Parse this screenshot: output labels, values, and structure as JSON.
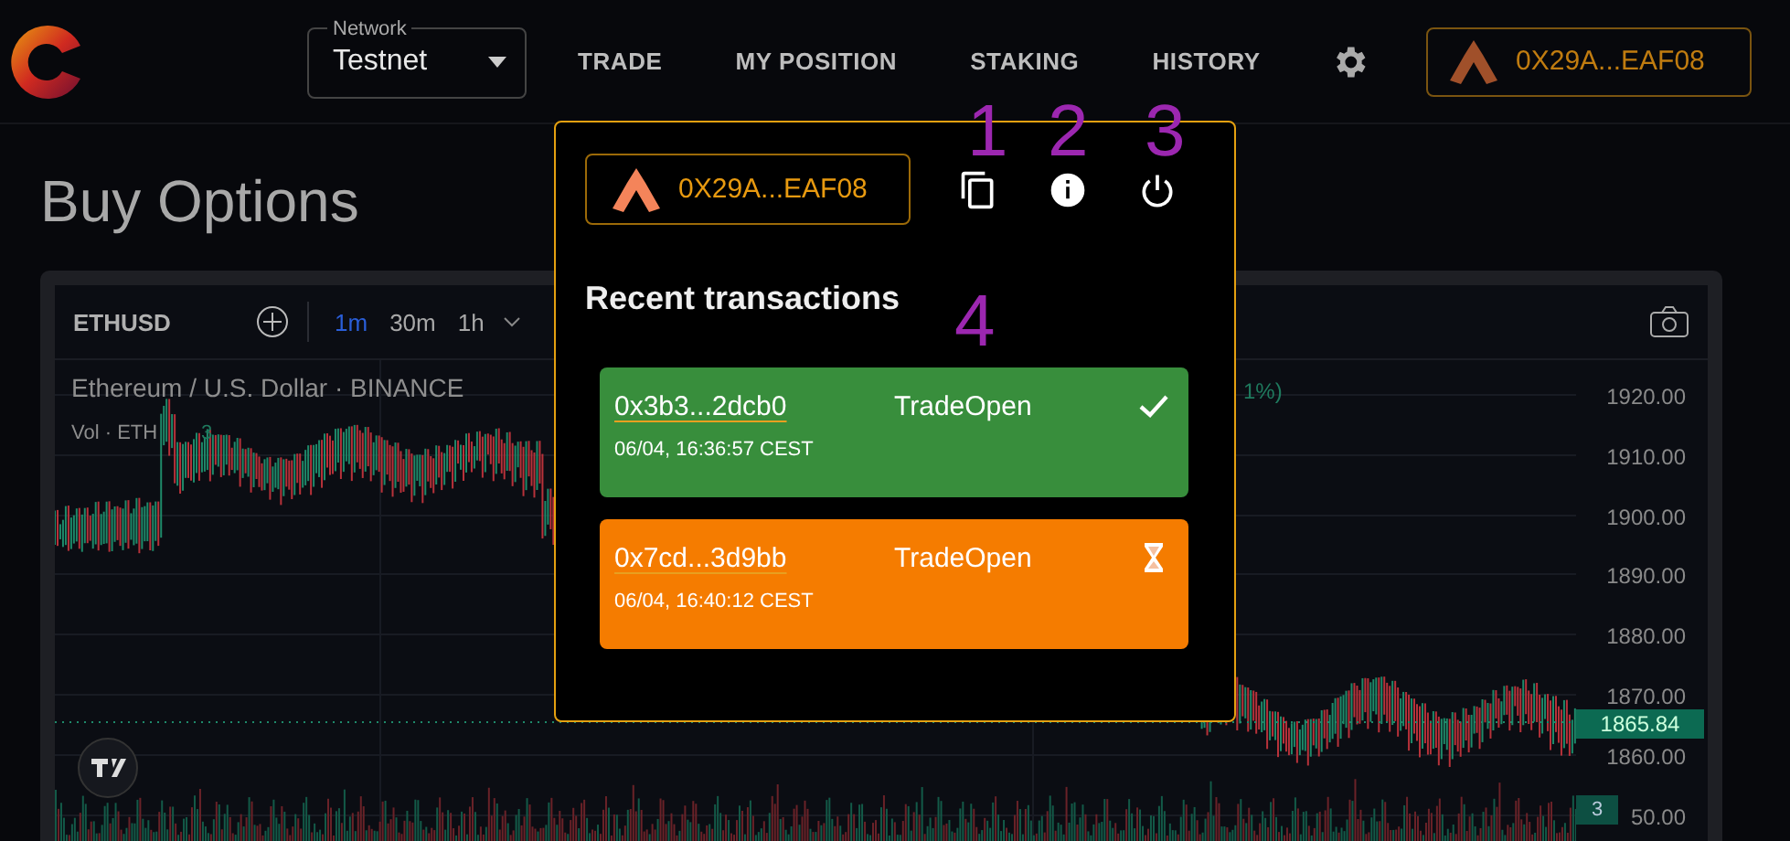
{
  "header": {
    "network": {
      "label": "Network",
      "value": "Testnet"
    },
    "nav": [
      {
        "label": "TRADE"
      },
      {
        "label": "MY POSITION"
      },
      {
        "label": "STAKING"
      },
      {
        "label": "HISTORY"
      }
    ],
    "wallet": "0X29A...EAF08"
  },
  "page_title": "Buy Options",
  "chart": {
    "symbol": "ETHUSD",
    "intervals": [
      {
        "label": "1m",
        "selected": true
      },
      {
        "label": "30m",
        "selected": false
      },
      {
        "label": "1h",
        "selected": false
      }
    ],
    "title": "Ethereum / U.S. Dollar · BINANCE",
    "change": "1%)",
    "volume_label": "Vol · ETH",
    "volume_value": "3",
    "y_labels": [
      "1920.00",
      "1910.00",
      "1900.00",
      "1890.00",
      "1880.00",
      "1870.00",
      "1860.00",
      "50.00"
    ],
    "last_price": "1865.84",
    "volume_badge": "3"
  },
  "popup": {
    "wallet": "0X29A...EAF08",
    "heading": "Recent transactions",
    "transactions": [
      {
        "hash": "0x3b3...2dcb0",
        "type": "TradeOpen",
        "time": "06/04, 16:36:57 CEST",
        "kind": "confirmed"
      },
      {
        "hash": "0x7cd...3d9bb",
        "type": "TradeOpen",
        "time": "06/04, 16:40:12 CEST",
        "kind": "pending"
      }
    ]
  },
  "annotations": [
    "1",
    "2",
    "3",
    "4"
  ]
}
